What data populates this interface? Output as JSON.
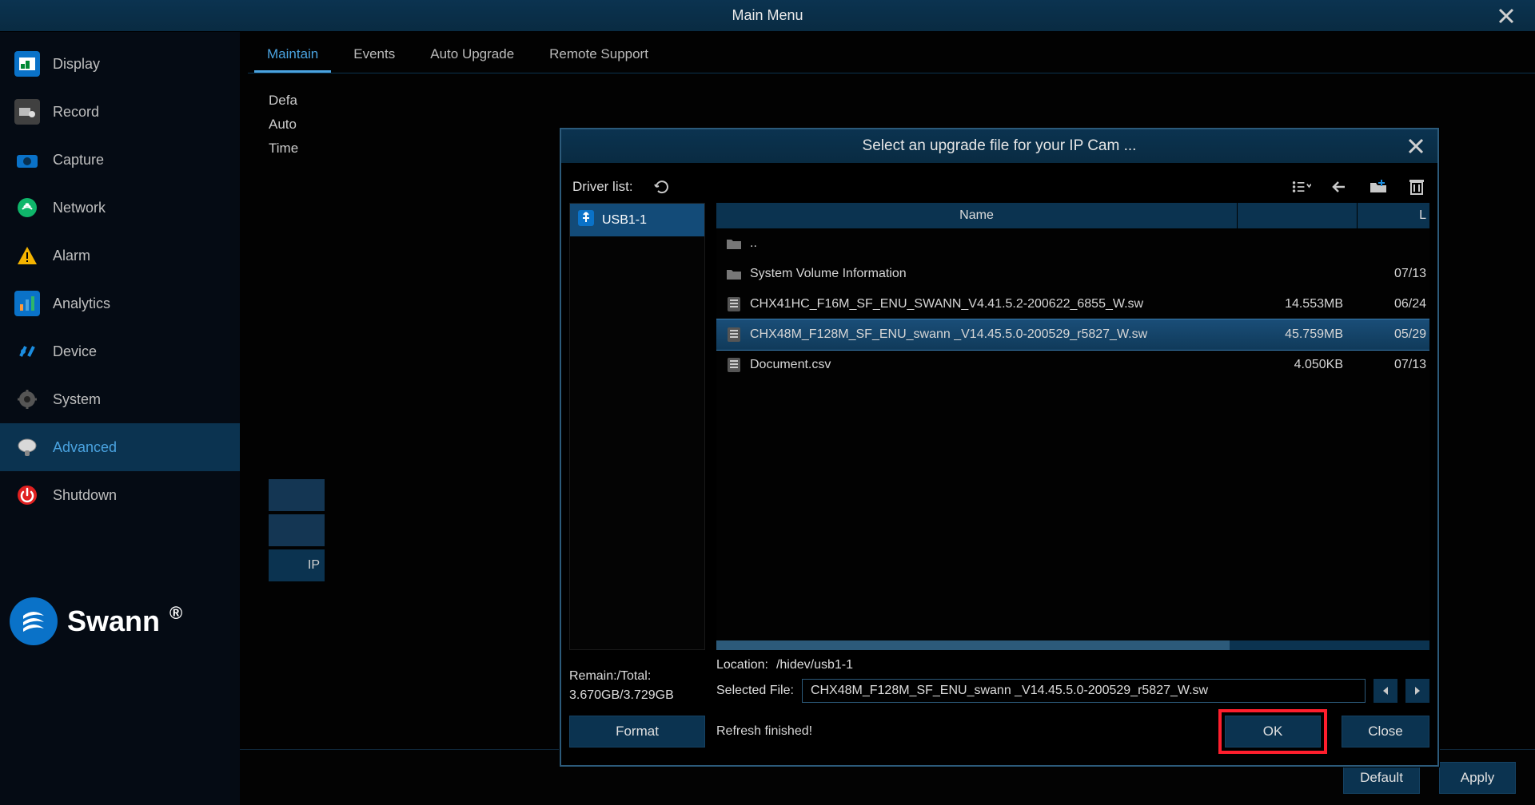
{
  "titlebar": {
    "title": "Main Menu"
  },
  "sidebar": {
    "items": [
      {
        "label": "Display"
      },
      {
        "label": "Record"
      },
      {
        "label": "Capture"
      },
      {
        "label": "Network"
      },
      {
        "label": "Alarm"
      },
      {
        "label": "Analytics"
      },
      {
        "label": "Device"
      },
      {
        "label": "System"
      },
      {
        "label": "Advanced"
      },
      {
        "label": "Shutdown"
      }
    ],
    "active_index": 8,
    "logo_text": "Swann"
  },
  "tabs": {
    "items": [
      {
        "label": "Maintain"
      },
      {
        "label": "Events"
      },
      {
        "label": "Auto Upgrade"
      },
      {
        "label": "Remote Support"
      }
    ],
    "active_index": 0
  },
  "form": {
    "rows": [
      "Defa",
      "Auto",
      "Time"
    ],
    "stub_label": "IP"
  },
  "bottom": {
    "default_label": "Default",
    "apply_label": "Apply"
  },
  "modal": {
    "title": "Select an upgrade file for your IP Cam ...",
    "driver_list_label": "Driver list:",
    "drive_name": "USB1-1",
    "columns": {
      "name": "Name",
      "size": "",
      "date": "L"
    },
    "files": [
      {
        "name": "..",
        "size": "",
        "date": "",
        "type": "up"
      },
      {
        "name": "System Volume Information",
        "size": "",
        "date": "07/13",
        "type": "folder"
      },
      {
        "name": "CHX41HC_F16M_SF_ENU_SWANN_V4.41.5.2-200622_6855_W.sw",
        "size": "14.553MB",
        "date": "06/24",
        "type": "file"
      },
      {
        "name": "CHX48M_F128M_SF_ENU_swann _V14.45.5.0-200529_r5827_W.sw",
        "size": "45.759MB",
        "date": "05/29",
        "type": "file",
        "selected": true
      },
      {
        "name": "Document.csv",
        "size": "4.050KB",
        "date": "07/13",
        "type": "file"
      }
    ],
    "remain_total_label": "Remain:/Total:",
    "remain_total_value": "3.670GB/3.729GB",
    "location_label": "Location:",
    "location_value": "/hidev/usb1-1",
    "selected_label": "Selected File:",
    "selected_value": "CHX48M_F128M_SF_ENU_swann _V14.45.5.0-200529_r5827_W.sw",
    "status_text": "Refresh finished!",
    "format_label": "Format",
    "ok_label": "OK",
    "close_label": "Close"
  }
}
